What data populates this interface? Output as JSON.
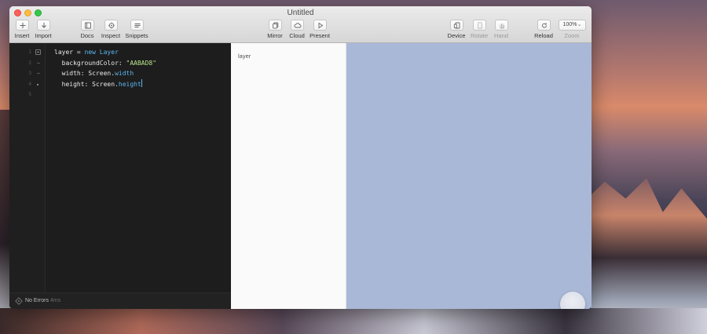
{
  "window": {
    "title": "Untitled"
  },
  "toolbar": {
    "insert": "Insert",
    "import": "Import",
    "docs": "Docs",
    "inspect": "Inspect",
    "snippets": "Snippets",
    "mirror": "Mirror",
    "cloud": "Cloud",
    "present": "Present",
    "device": "Device",
    "rotate": "Rotate",
    "hand": "Hand",
    "reload": "Reload",
    "zoom_value": "100%",
    "zoom_label": "Zoom"
  },
  "editor": {
    "line_numbers": [
      "1",
      "2",
      "3",
      "4",
      "5"
    ],
    "lines": {
      "l1_var": "layer = ",
      "l1_kw": "new Layer",
      "l2_key": "  backgroundColor: ",
      "l2_str": "\"AABAD8\"",
      "l3_key": "  width: Screen.",
      "l3_prop": "width",
      "l4_key": "  height: Screen.",
      "l4_prop": "height"
    }
  },
  "status": {
    "text": "No Errors",
    "time": "4ms"
  },
  "layers": {
    "items": [
      "layer"
    ]
  },
  "preview": {
    "background_color": "#AABAD8"
  },
  "colors": {
    "keyword": "#5cb6ef",
    "string": "#b6e38a",
    "editor_bg": "#1d1d1d"
  }
}
